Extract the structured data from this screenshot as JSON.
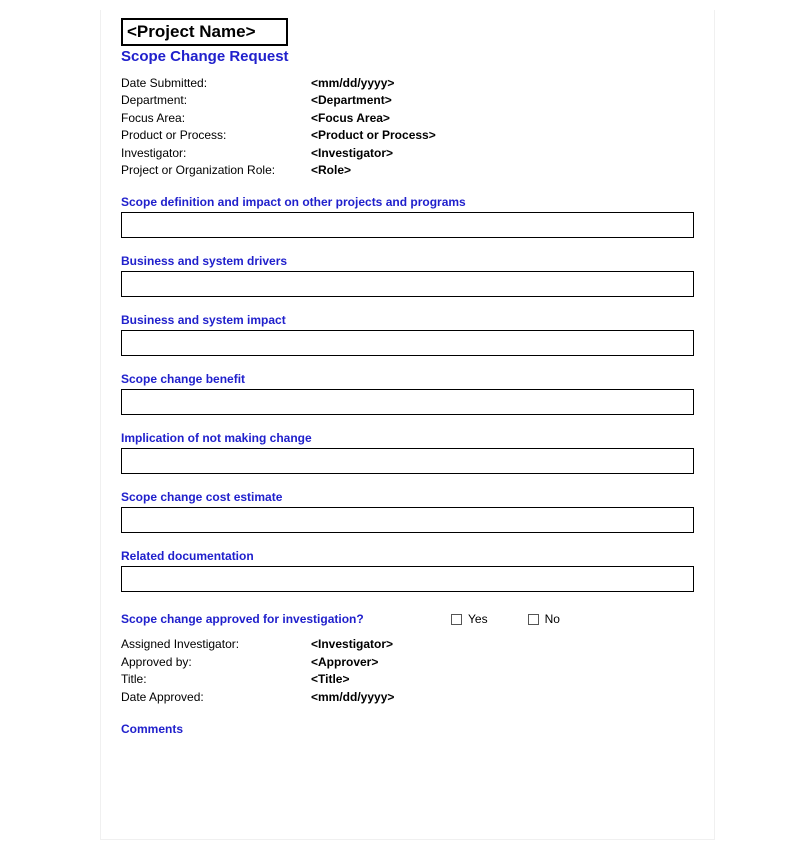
{
  "header": {
    "project_name": "<Project Name>",
    "title": "Scope Change Request"
  },
  "info": {
    "date_submitted_label": "Date Submitted:",
    "date_submitted_value": "<mm/dd/yyyy>",
    "department_label": "Department:",
    "department_value": "<Department>",
    "focus_area_label": "Focus Area:",
    "focus_area_value": "<Focus Area>",
    "product_process_label": "Product or Process:",
    "product_process_value": "<Product or Process>",
    "investigator_label": "Investigator:",
    "investigator_value": "<Investigator>",
    "role_label": "Project or Organization Role:",
    "role_value": "<Role>"
  },
  "sections": {
    "scope_def": "Scope definition and impact on other projects and programs",
    "drivers": "Business and system drivers",
    "impact": "Business and system impact",
    "benefit": "Scope change benefit",
    "implication": "Implication of not making change",
    "cost": "Scope change cost estimate",
    "docs": "Related documentation",
    "comments": "Comments"
  },
  "approval": {
    "question": "Scope change approved for investigation?",
    "yes": "Yes",
    "no": "No",
    "assigned_label": "Assigned Investigator:",
    "assigned_value": "<Investigator>",
    "approved_by_label": "Approved by:",
    "approved_by_value": "<Approver>",
    "title_label": "Title:",
    "title_value": "<Title>",
    "date_label": "Date Approved:",
    "date_value": "<mm/dd/yyyy>"
  }
}
